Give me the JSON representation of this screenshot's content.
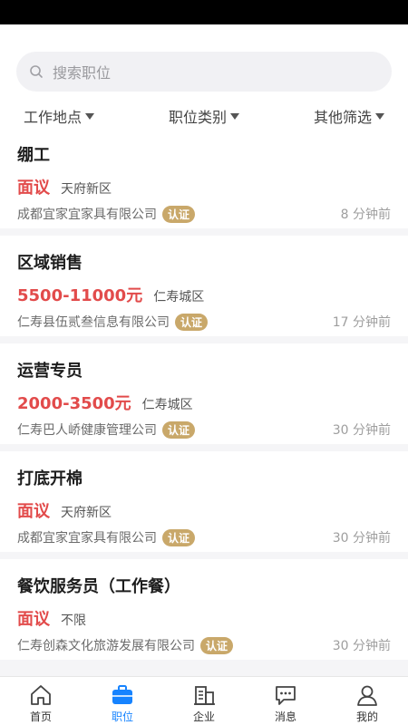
{
  "search": {
    "placeholder": "搜索职位"
  },
  "filters": [
    {
      "label": "工作地点"
    },
    {
      "label": "职位类别"
    },
    {
      "label": "其他筛选"
    }
  ],
  "jobs": [
    {
      "title": "绷工",
      "salary": "面议",
      "location": "天府新区",
      "company": "成都宜家宜家具有限公司",
      "badge": "认证",
      "time": "8 分钟前"
    },
    {
      "title": "区域销售",
      "salary": "5500-11000元",
      "location": "仁寿城区",
      "company": "仁寿县伍贰叁信息有限公司",
      "badge": "认证",
      "time": "17 分钟前"
    },
    {
      "title": "运营专员",
      "salary": "2000-3500元",
      "location": "仁寿城区",
      "company": "仁寿巴人峤健康管理公司",
      "badge": "认证",
      "time": "30 分钟前"
    },
    {
      "title": "打底开棉",
      "salary": "面议",
      "location": "天府新区",
      "company": "成都宜家宜家具有限公司",
      "badge": "认证",
      "time": "30 分钟前"
    },
    {
      "title": "餐饮服务员（工作餐）",
      "salary": "面议",
      "location": "不限",
      "company": "仁寿创森文化旅游发展有限公司",
      "badge": "认证",
      "time": "30 分钟前"
    }
  ],
  "tabbar": [
    {
      "label": "首页",
      "icon": "home-icon"
    },
    {
      "label": "职位",
      "icon": "briefcase-icon"
    },
    {
      "label": "企业",
      "icon": "building-icon"
    },
    {
      "label": "消息",
      "icon": "message-icon"
    },
    {
      "label": "我的",
      "icon": "user-icon"
    }
  ],
  "colors": {
    "accent": "#1683ff",
    "salary": "#e24b4b",
    "badge": "#c9a86a"
  }
}
